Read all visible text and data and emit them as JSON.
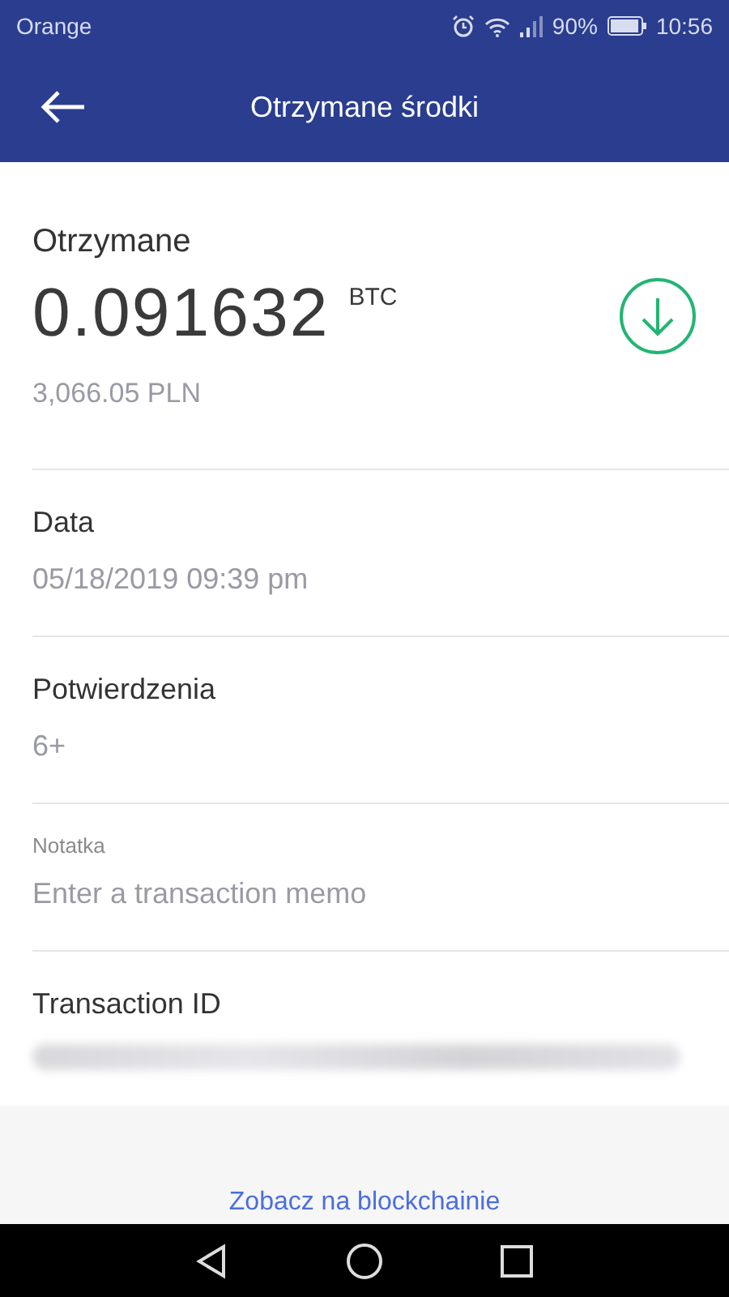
{
  "status_bar": {
    "carrier": "Orange",
    "battery": "90%",
    "time": "10:56"
  },
  "app_bar": {
    "title": "Otrzymane środki"
  },
  "amount": {
    "label": "Otrzymane",
    "value": "0.091632",
    "unit": "BTC",
    "fiat": "3,066.05 PLN"
  },
  "details": [
    {
      "kind": "text",
      "label": "Data",
      "value": "05/18/2019 09:39 pm"
    },
    {
      "kind": "text",
      "label": "Potwierdzenia",
      "value": "6+"
    },
    {
      "kind": "input",
      "label": "Notatka",
      "placeholder": "Enter a transaction memo"
    },
    {
      "kind": "redacted",
      "label": "Transaction ID"
    }
  ],
  "link": "Zobacz na blockchainie"
}
